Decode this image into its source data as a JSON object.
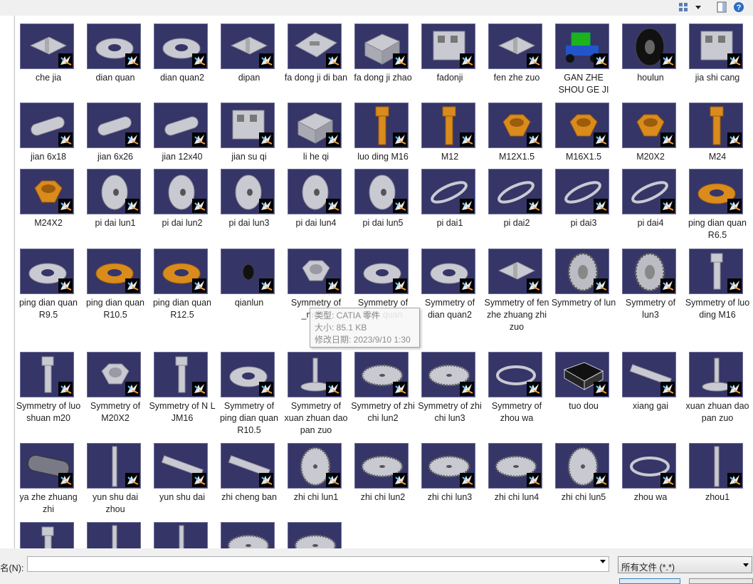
{
  "toolbar": {
    "view_icon": "view-menu-icon",
    "dropdown_icon": "chevron-down-icon",
    "preview_icon": "preview-pane-icon",
    "help_icon": "help-icon",
    "help_label": "?"
  },
  "items": [
    {
      "label": "che jia",
      "shape": "bracket"
    },
    {
      "label": "dian quan",
      "shape": "washer"
    },
    {
      "label": "dian quan2",
      "shape": "washer"
    },
    {
      "label": "dipan",
      "shape": "bracket"
    },
    {
      "label": "fa dong ji di ban",
      "shape": "plate"
    },
    {
      "label": "fa dong ji zhao",
      "shape": "box"
    },
    {
      "label": "fadonji",
      "shape": "engine"
    },
    {
      "label": "fen zhe zuo",
      "shape": "bracket"
    },
    {
      "label": "GAN ZHE SHOU GE JI",
      "shape": "machine"
    },
    {
      "label": "houlun",
      "shape": "tire"
    },
    {
      "label": "jia shi cang",
      "shape": "engine"
    },
    {
      "label": "jian 6x18",
      "shape": "key"
    },
    {
      "label": "jian 6x26",
      "shape": "key"
    },
    {
      "label": "jian 12x40",
      "shape": "key"
    },
    {
      "label": "jian su qi",
      "shape": "engine"
    },
    {
      "label": "li he qi",
      "shape": "box"
    },
    {
      "label": "luo ding M16",
      "shape": "bolt-orange"
    },
    {
      "label": "M12",
      "shape": "bolt-orange"
    },
    {
      "label": "M12X1.5",
      "shape": "nut-orange"
    },
    {
      "label": "M16X1.5",
      "shape": "nut-orange"
    },
    {
      "label": "M20X2",
      "shape": "nut-orange"
    },
    {
      "label": "M24",
      "shape": "bolt-orange"
    },
    {
      "label": "M24X2",
      "shape": "nut-orange"
    },
    {
      "label": "pi dai lun1",
      "shape": "pulley"
    },
    {
      "label": "pi dai lun2",
      "shape": "pulley"
    },
    {
      "label": "pi dai lun3",
      "shape": "pulley"
    },
    {
      "label": "pi dai lun4",
      "shape": "pulley"
    },
    {
      "label": "pi dai lun5",
      "shape": "pulley"
    },
    {
      "label": "pi dai1",
      "shape": "belt"
    },
    {
      "label": "pi dai2",
      "shape": "belt"
    },
    {
      "label": "pi dai3",
      "shape": "belt"
    },
    {
      "label": "pi dai4",
      "shape": "belt"
    },
    {
      "label": "ping dian quan R6.5",
      "shape": "washer-orange"
    },
    {
      "label": "ping dian quan R9.5",
      "shape": "washer"
    },
    {
      "label": "ping dian quan R10.5",
      "shape": "washer-orange"
    },
    {
      "label": "ping dian quan R12.5",
      "shape": "washer-orange"
    },
    {
      "label": "qianlun",
      "shape": "small-tire"
    },
    {
      "label": "Symmetry of _model",
      "shape": "nut"
    },
    {
      "label": "Symmetry of dian quan",
      "shape": "washer"
    },
    {
      "label": "Symmetry of dian quan2",
      "shape": "washer"
    },
    {
      "label": "Symmetry of fen zhe zhuang zhi zuo",
      "shape": "bracket"
    },
    {
      "label": "Symmetry of lun",
      "shape": "tire-gray"
    },
    {
      "label": "Symmetry of lun3",
      "shape": "tire-gray"
    },
    {
      "label": "Symmetry of luo ding M16",
      "shape": "bolt"
    },
    {
      "label": "Symmetry of luo shuan m20",
      "shape": "bolt"
    },
    {
      "label": "Symmetry of M20X2",
      "shape": "nut"
    },
    {
      "label": "Symmetry of N L JM16",
      "shape": "bolt"
    },
    {
      "label": "Symmetry of ping dian quan R10.5",
      "shape": "washer"
    },
    {
      "label": "Symmetry of xuan zhuan dao pan zuo",
      "shape": "spindle"
    },
    {
      "label": "Symmetry of zhi chi lun2",
      "shape": "gear"
    },
    {
      "label": "Symmetry of zhi chi lun3",
      "shape": "gear"
    },
    {
      "label": "Symmetry of zhou wa",
      "shape": "ring"
    },
    {
      "label": "tuo dou",
      "shape": "tray"
    },
    {
      "label": "xiang gai",
      "shape": "bar"
    },
    {
      "label": "xuan zhuan dao pan zuo",
      "shape": "spindle"
    },
    {
      "label": "ya zhe zhuang zhi",
      "shape": "roller"
    },
    {
      "label": "yun shu dai zhou",
      "shape": "shaft"
    },
    {
      "label": "yun shu dai",
      "shape": "bar"
    },
    {
      "label": "zhi cheng ban",
      "shape": "bar"
    },
    {
      "label": "zhi chi lun1",
      "shape": "gear-side"
    },
    {
      "label": "zhi chi lun2",
      "shape": "gear"
    },
    {
      "label": "zhi chi lun3",
      "shape": "gear"
    },
    {
      "label": "zhi chi lun4",
      "shape": "gear"
    },
    {
      "label": "zhi chi lun5",
      "shape": "gear-side"
    },
    {
      "label": "zhou wa",
      "shape": "ring"
    },
    {
      "label": "zhou1",
      "shape": "shaft"
    },
    {
      "label": "",
      "shape": "bolt"
    },
    {
      "label": "",
      "shape": "shaft"
    },
    {
      "label": "",
      "shape": "shaft"
    },
    {
      "label": "",
      "shape": "gear"
    },
    {
      "label": "",
      "shape": "gear"
    }
  ],
  "tooltip": {
    "type_line": "类型: CATIA 零件",
    "size_line": "大小: 85.1 KB",
    "date_line": "修改日期: 2023/9/10 1:30"
  },
  "bottom": {
    "filename_label": "名(N):",
    "filename_value": "",
    "filetype_value": "所有文件 (*.*)"
  },
  "colors": {
    "thumb_bg": "#353568",
    "part_gray": "#c8c8d0",
    "part_orange": "#d88a1a"
  }
}
